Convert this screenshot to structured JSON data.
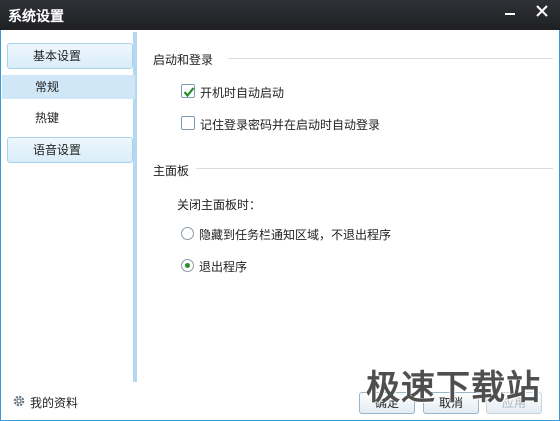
{
  "window": {
    "title": "系统设置",
    "minimize_icon": "minimize-icon",
    "close_icon": "close-icon",
    "accent_color": "#3a9ad6"
  },
  "sidebar": {
    "groups": [
      {
        "label": "基本设置",
        "items": [
          {
            "label": "常规",
            "selected": true
          },
          {
            "label": "热键",
            "selected": false
          }
        ]
      },
      {
        "label": "语音设置"
      }
    ],
    "profile": {
      "icon": "gear-icon",
      "label": "我的资料"
    }
  },
  "main": {
    "startup_section": {
      "title": "启动和登录",
      "options": [
        {
          "label": "开机时自动启动",
          "checked": true
        },
        {
          "label": "记住登录密码并在启动时自动登录",
          "checked": false
        }
      ]
    },
    "panel_section": {
      "title": "主面板",
      "question": "关闭主面板时：",
      "options": [
        {
          "label": "隐藏到任务栏通知区域，不退出程序",
          "selected": false
        },
        {
          "label": "退出程序",
          "selected": true
        }
      ]
    }
  },
  "footer": {
    "ok_label": "确定",
    "cancel_label": "取消",
    "apply_label": "应用"
  },
  "watermark": {
    "text": "极速下载站"
  }
}
